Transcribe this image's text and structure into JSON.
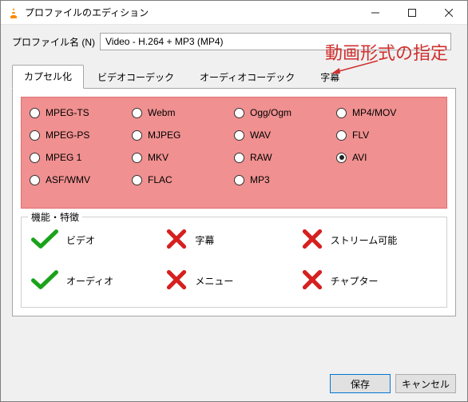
{
  "window": {
    "title": "プロファイルのエディション"
  },
  "profile": {
    "label": "プロファイル名 (N)",
    "value": "Video - H.264 + MP3 (MP4)"
  },
  "annotation": "動画形式の指定",
  "tabs": {
    "t0": "カプセル化",
    "t1": "ビデオコーデック",
    "t2": "オーディオコーデック",
    "t3": "字幕"
  },
  "formats": {
    "f0": "MPEG-TS",
    "f1": "Webm",
    "f2": "Ogg/Ogm",
    "f3": "MP4/MOV",
    "f4": "MPEG-PS",
    "f5": "MJPEG",
    "f6": "WAV",
    "f7": "FLV",
    "f8": "MPEG 1",
    "f9": "MKV",
    "f10": "RAW",
    "f11": "AVI",
    "f12": "ASF/WMV",
    "f13": "FLAC",
    "f14": "MP3"
  },
  "selected_format": "AVI",
  "features": {
    "legend": "機能・特徴",
    "video": {
      "label": "ビデオ",
      "ok": true
    },
    "sub": {
      "label": "字幕",
      "ok": false
    },
    "stream": {
      "label": "ストリーム可能",
      "ok": false
    },
    "audio": {
      "label": "オーディオ",
      "ok": true
    },
    "menu": {
      "label": "メニュー",
      "ok": false
    },
    "chapter": {
      "label": "チャプター",
      "ok": false
    }
  },
  "buttons": {
    "save": "保存",
    "cancel": "キャンセル"
  }
}
